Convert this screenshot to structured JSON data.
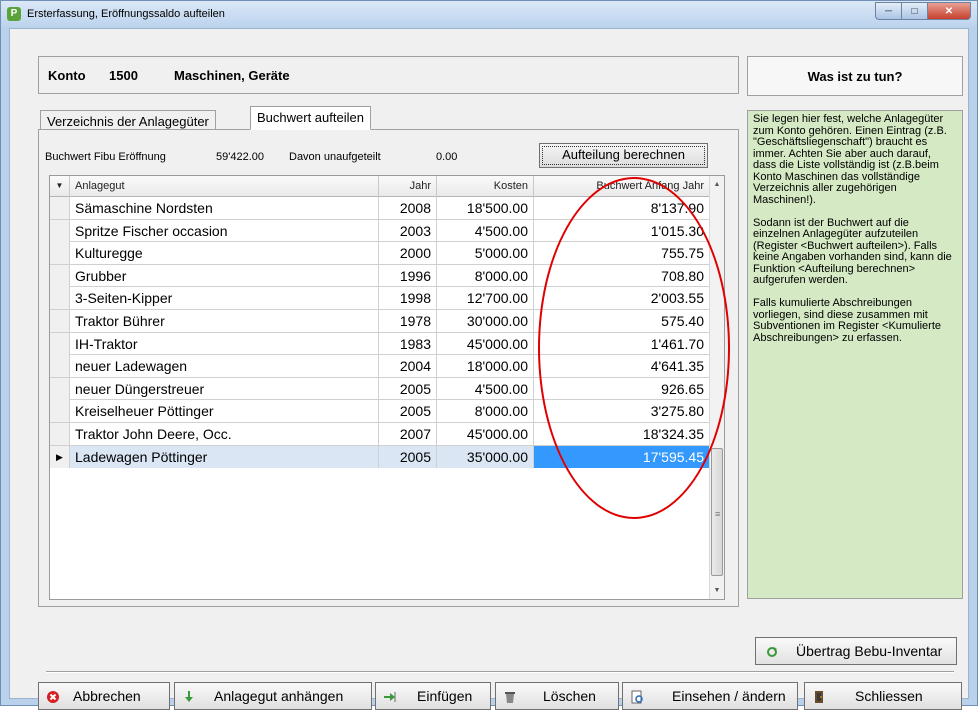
{
  "window": {
    "title": "Ersterfassung, Eröffnungssaldo aufteilen",
    "app_icon_letter": "P"
  },
  "account": {
    "label": "Konto",
    "number": "1500",
    "name": "Maschinen, Geräte"
  },
  "help": {
    "heading": "Was ist zu tun?",
    "text": "Sie legen hier fest, welche Anlagegüter zum Konto gehören. Einen Eintrag (z.B. \"Geschäftsliegenschaft\") braucht es immer. Achten Sie aber auch darauf, dass die Liste vollständig ist (z.B.beim Konto Maschinen das vollständige Verzeichnis aller zugehörigen Maschinen!).\n\nSodann ist der Buchwert auf die einzelnen Anlagegüter aufzuteilen (Register <Buchwert aufteilen>). Falls keine Angaben vorhanden sind, kann die Funktion <Aufteilung berechnen> aufgerufen werden.\n\nFalls kumulierte Abschreibungen vorliegen, sind diese zusammen mit Subventionen im Register <Kumulierte Abschreibungen> zu erfassen."
  },
  "tabs": [
    {
      "label": "Verzeichnis der Anlagegüter",
      "active": false
    },
    {
      "label": "Buchwert aufteilen",
      "active": true
    }
  ],
  "summary": {
    "buchwert_label": "Buchwert Fibu Eröffnung",
    "buchwert_value": "59'422.00",
    "unaufgeteilt_label": "Davon unaufgeteilt",
    "unaufgeteilt_value": "0.00",
    "calc_button": "Aufteilung berechnen"
  },
  "grid": {
    "columns": [
      "Anlagegut",
      "Jahr",
      "Kosten",
      "Buchwert Anfang Jahr"
    ],
    "rows": [
      {
        "name": "Sämaschine Nordsten",
        "jahr": "2008",
        "kosten": "18'500.00",
        "buchwert": "8'137.90"
      },
      {
        "name": "Spritze Fischer occasion",
        "jahr": "2003",
        "kosten": "4'500.00",
        "buchwert": "1'015.30"
      },
      {
        "name": "Kulturegge",
        "jahr": "2000",
        "kosten": "5'000.00",
        "buchwert": "755.75"
      },
      {
        "name": "Grubber",
        "jahr": "1996",
        "kosten": "8'000.00",
        "buchwert": "708.80"
      },
      {
        "name": "3-Seiten-Kipper",
        "jahr": "1998",
        "kosten": "12'700.00",
        "buchwert": "2'003.55"
      },
      {
        "name": "Traktor Bührer",
        "jahr": "1978",
        "kosten": "30'000.00",
        "buchwert": "575.40"
      },
      {
        "name": "IH-Traktor",
        "jahr": "1983",
        "kosten": "45'000.00",
        "buchwert": "1'461.70"
      },
      {
        "name": "neuer Ladewagen",
        "jahr": "2004",
        "kosten": "18'000.00",
        "buchwert": "4'641.35"
      },
      {
        "name": "neuer Düngerstreuer",
        "jahr": "2005",
        "kosten": "4'500.00",
        "buchwert": "926.65"
      },
      {
        "name": "Kreiselheuer Pöttinger",
        "jahr": "2005",
        "kosten": "8'000.00",
        "buchwert": "3'275.80"
      },
      {
        "name": "Traktor John Deere, Occ.",
        "jahr": "2007",
        "kosten": "45'000.00",
        "buchwert": "18'324.35"
      },
      {
        "name": "Ladewagen Pöttinger",
        "jahr": "2005",
        "kosten": "35'000.00",
        "buchwert": "17'595.45",
        "selected": true
      }
    ]
  },
  "buttons": {
    "uebertrag": "Übertrag Bebu-Inventar",
    "abbrechen": "Abbrechen",
    "anhaengen": "Anlagegut anhängen",
    "einfuegen": "Einfügen",
    "loeschen": "Löschen",
    "einsehen": "Einsehen / ändern",
    "schliessen": "Schliessen"
  },
  "colors": {
    "help_background": "#d4e9c4",
    "selection": "#3399ff",
    "annotation_ellipse": "#e00000"
  }
}
